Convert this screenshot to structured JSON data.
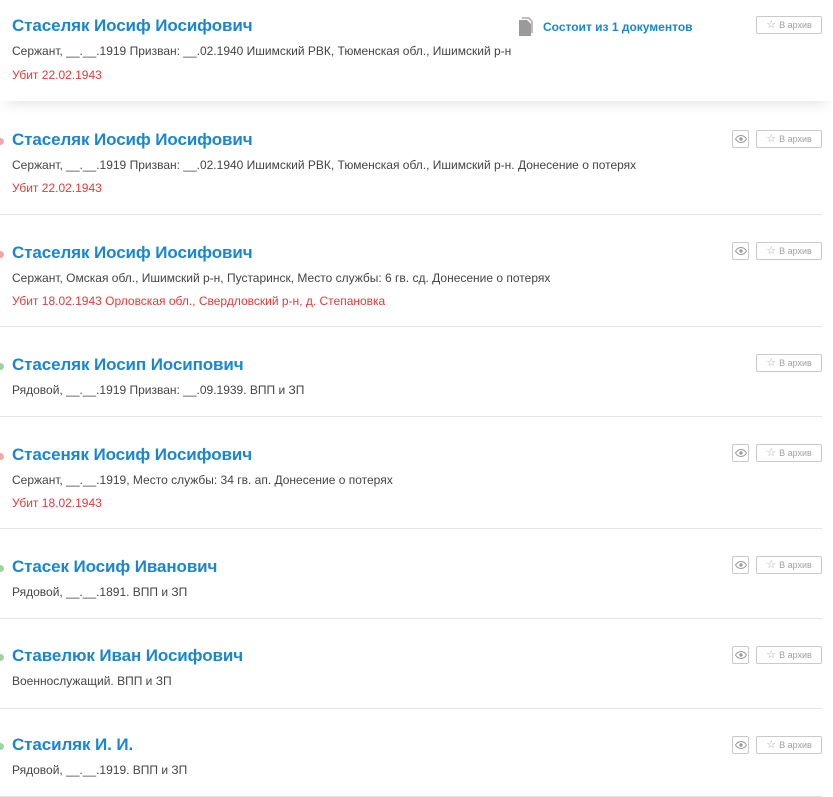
{
  "colors": {
    "accent": "#1a86d0",
    "killed": "#e03a3a",
    "dot_red": "#f3a7a7",
    "dot_green": "#9fd39f"
  },
  "icons": {
    "archive": "star-outline-icon",
    "view": "eye-icon",
    "documents": "document-stack-icon"
  },
  "archive_label": "В архив",
  "records": [
    {
      "name": "Стаселяк Иосиф Иосифович",
      "info": "Сержант, __.__.1919 Призван: __.02.1940 Ишимский РВК, Тюменская обл., Ишимский р-н",
      "death": "Убит 22.02.1943",
      "docs_label": "Состоит из 1 документов",
      "dot": ""
    },
    {
      "name": "Стаселяк Иосиф Иосифович",
      "info": "Сержант, __.__.1919 Призван: __.02.1940 Ишимский РВК, Тюменская обл., Ишимский р-н. Донесение о потерях",
      "death": "Убит 22.02.1943",
      "dot": "red"
    },
    {
      "name": "Стаселяк Иосиф Иосифович",
      "info": "Сержант, Омская обл., Ишимский р-н, Пустаринск, Место службы: 6 гв. сд. Донесение о потерях",
      "death": "Убит 18.02.1943 Орловская обл., Свердловский р-н, д. Степановка",
      "dot": "red"
    },
    {
      "name": "Стаселяк Иосип Иосипович",
      "info": "Рядовой, __.__.1919 Призван: __.09.1939. ВПП и ЗП",
      "death": "",
      "dot": "green"
    },
    {
      "name": "Стасеняк Иосиф Иосифович",
      "info": "Сержант, __.__.1919, Место службы: 34 гв. ап. Донесение о потерях",
      "death": "Убит 18.02.1943",
      "dot": "red"
    },
    {
      "name": "Стасек Иосиф Иванович",
      "info": "Рядовой, __.__.1891. ВПП и ЗП",
      "death": "",
      "dot": "green"
    },
    {
      "name": "Ставелюк Иван Иосифович",
      "info": "Военнослужащий. ВПП и ЗП",
      "death": "",
      "dot": "green"
    },
    {
      "name": "Стасиляк И. И.",
      "info": "Рядовой, __.__.1919. ВПП и ЗП",
      "death": "",
      "dot": "green"
    }
  ]
}
